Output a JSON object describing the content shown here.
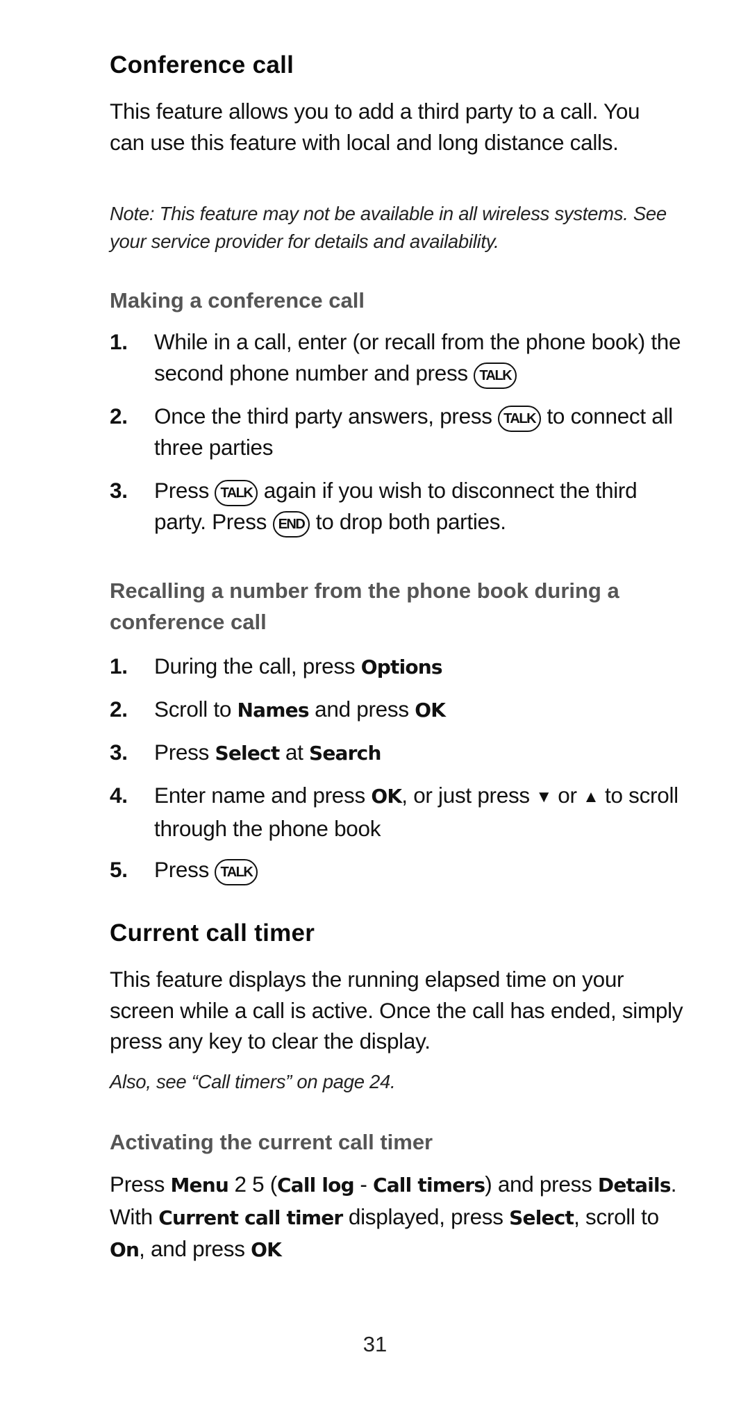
{
  "sections": {
    "conference": {
      "title": "Conference call",
      "intro": "This feature allows you to add a third party to a call. You can use this feature with local and long distance calls.",
      "note": "Note: This feature may not be available in all wireless systems. See your service provider for details and availability."
    },
    "making": {
      "title": "Making a conference call",
      "steps": [
        {
          "num": "1.",
          "a": "While in a call, enter (or recall from the phone book) the second phone number and press ",
          "key": "TALK"
        },
        {
          "num": "2.",
          "a": "Once the third party answers, press ",
          "key": "TALK",
          "b": " to connect all three parties"
        },
        {
          "num": "3.",
          "a": "Press ",
          "key": "TALK",
          "b": " again if you wish to disconnect the third party. Press ",
          "key2": "END",
          "c": " to drop both parties."
        }
      ]
    },
    "recalling": {
      "title": "Recalling a number from the phone book during a conference call",
      "steps": [
        {
          "num": "1.",
          "a": "During the call, press ",
          "b1": "Options"
        },
        {
          "num": "2.",
          "a": "Scroll to ",
          "b1": "Names",
          "c": " and press ",
          "b2": "OK"
        },
        {
          "num": "3.",
          "a": "Press ",
          "b1": "Select",
          "c": " at ",
          "b2": "Search"
        },
        {
          "num": "4.",
          "a": "Enter name and press ",
          "b1": "OK",
          "c": ", or just press ",
          "down": "▼",
          "d": " or ",
          "up": "▲",
          "e": " to scroll through the phone book"
        },
        {
          "num": "5.",
          "a": "Press ",
          "key": "TALK"
        }
      ]
    },
    "timer": {
      "title": "Current call timer",
      "intro": "This feature displays the running elapsed time on your screen while a call is active. Once the call has ended, simply press any key to clear the display.",
      "note": "Also, see “Call timers” on page 24."
    },
    "activating": {
      "title": "Activating the current call timer",
      "p1": "Press ",
      "menu": "Menu",
      "p2": " 2 5 (",
      "calllog": "Call log",
      "p3": " - ",
      "calltimers": "Call timers",
      "p4": ") and press ",
      "details": "Details",
      "p5": ". With ",
      "current": "Current call timer",
      "p6": " displayed, press ",
      "select": "Select",
      "p7": ", scroll to ",
      "on": "On",
      "p8": ", and press ",
      "ok": "OK"
    }
  },
  "page_number": "31"
}
